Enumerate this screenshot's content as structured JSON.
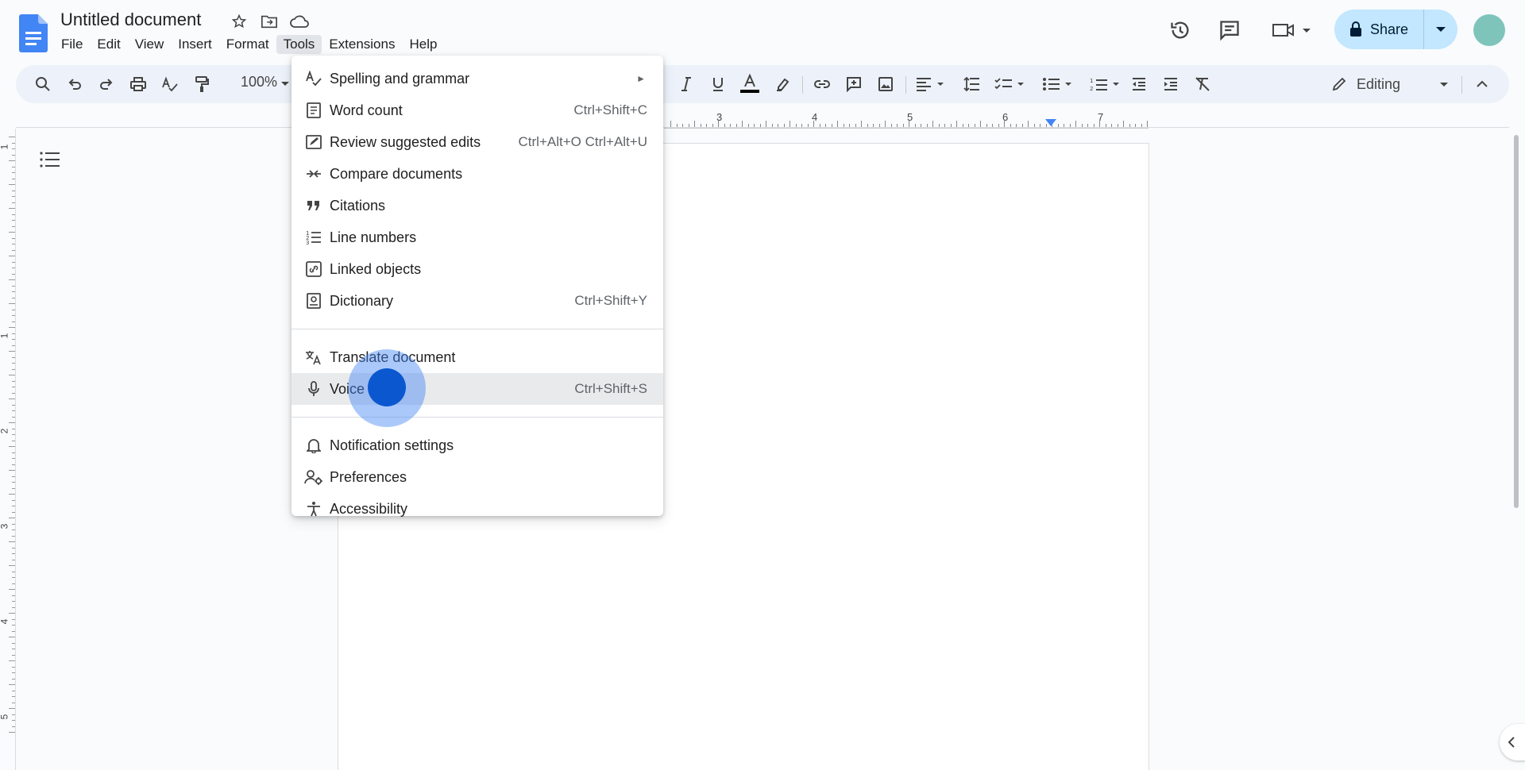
{
  "document": {
    "title": "Untitled document"
  },
  "menubar": {
    "items": [
      "File",
      "Edit",
      "View",
      "Insert",
      "Format",
      "Tools",
      "Extensions",
      "Help"
    ],
    "active": "Tools"
  },
  "header": {
    "share_label": "Share"
  },
  "toolbar": {
    "zoom": "100%",
    "mode": "Editing"
  },
  "ruler": {
    "numbers": [
      "3",
      "4",
      "5",
      "6",
      "7"
    ]
  },
  "vruler": {
    "numbers": [
      "1",
      "1",
      "2",
      "3",
      "4",
      "5"
    ]
  },
  "tools_menu": {
    "items": [
      {
        "label": "Spelling and grammar",
        "shortcut": "",
        "icon": "spellcheck-icon",
        "submenu": true
      },
      {
        "label": "Word count",
        "shortcut": "Ctrl+Shift+C",
        "icon": "word-count-icon"
      },
      {
        "label": "Review suggested edits",
        "shortcut": "Ctrl+Alt+O Ctrl+Alt+U",
        "icon": "review-edits-icon"
      },
      {
        "label": "Compare documents",
        "shortcut": "",
        "icon": "compare-icon"
      },
      {
        "label": "Citations",
        "shortcut": "",
        "icon": "quote-icon"
      },
      {
        "label": "Line numbers",
        "shortcut": "",
        "icon": "line-numbers-icon"
      },
      {
        "label": "Linked objects",
        "shortcut": "",
        "icon": "linked-objects-icon"
      },
      {
        "label": "Dictionary",
        "shortcut": "Ctrl+Shift+Y",
        "icon": "dictionary-icon"
      },
      {
        "label": "Translate document",
        "shortcut": "",
        "icon": "translate-icon"
      },
      {
        "label": "Voice typing",
        "shortcut": "Ctrl+Shift+S",
        "icon": "microphone-icon"
      },
      {
        "label": "Notification settings",
        "shortcut": "",
        "icon": "bell-icon"
      },
      {
        "label": "Preferences",
        "shortcut": "",
        "icon": "preferences-icon"
      },
      {
        "label": "Accessibility",
        "shortcut": "",
        "icon": "accessibility-icon"
      }
    ],
    "visible_voice_label": "Voice"
  },
  "colors": {
    "accent": "#0b57d0",
    "share_bg": "#c2e7ff",
    "toolbar_bg": "#edf2fa"
  }
}
